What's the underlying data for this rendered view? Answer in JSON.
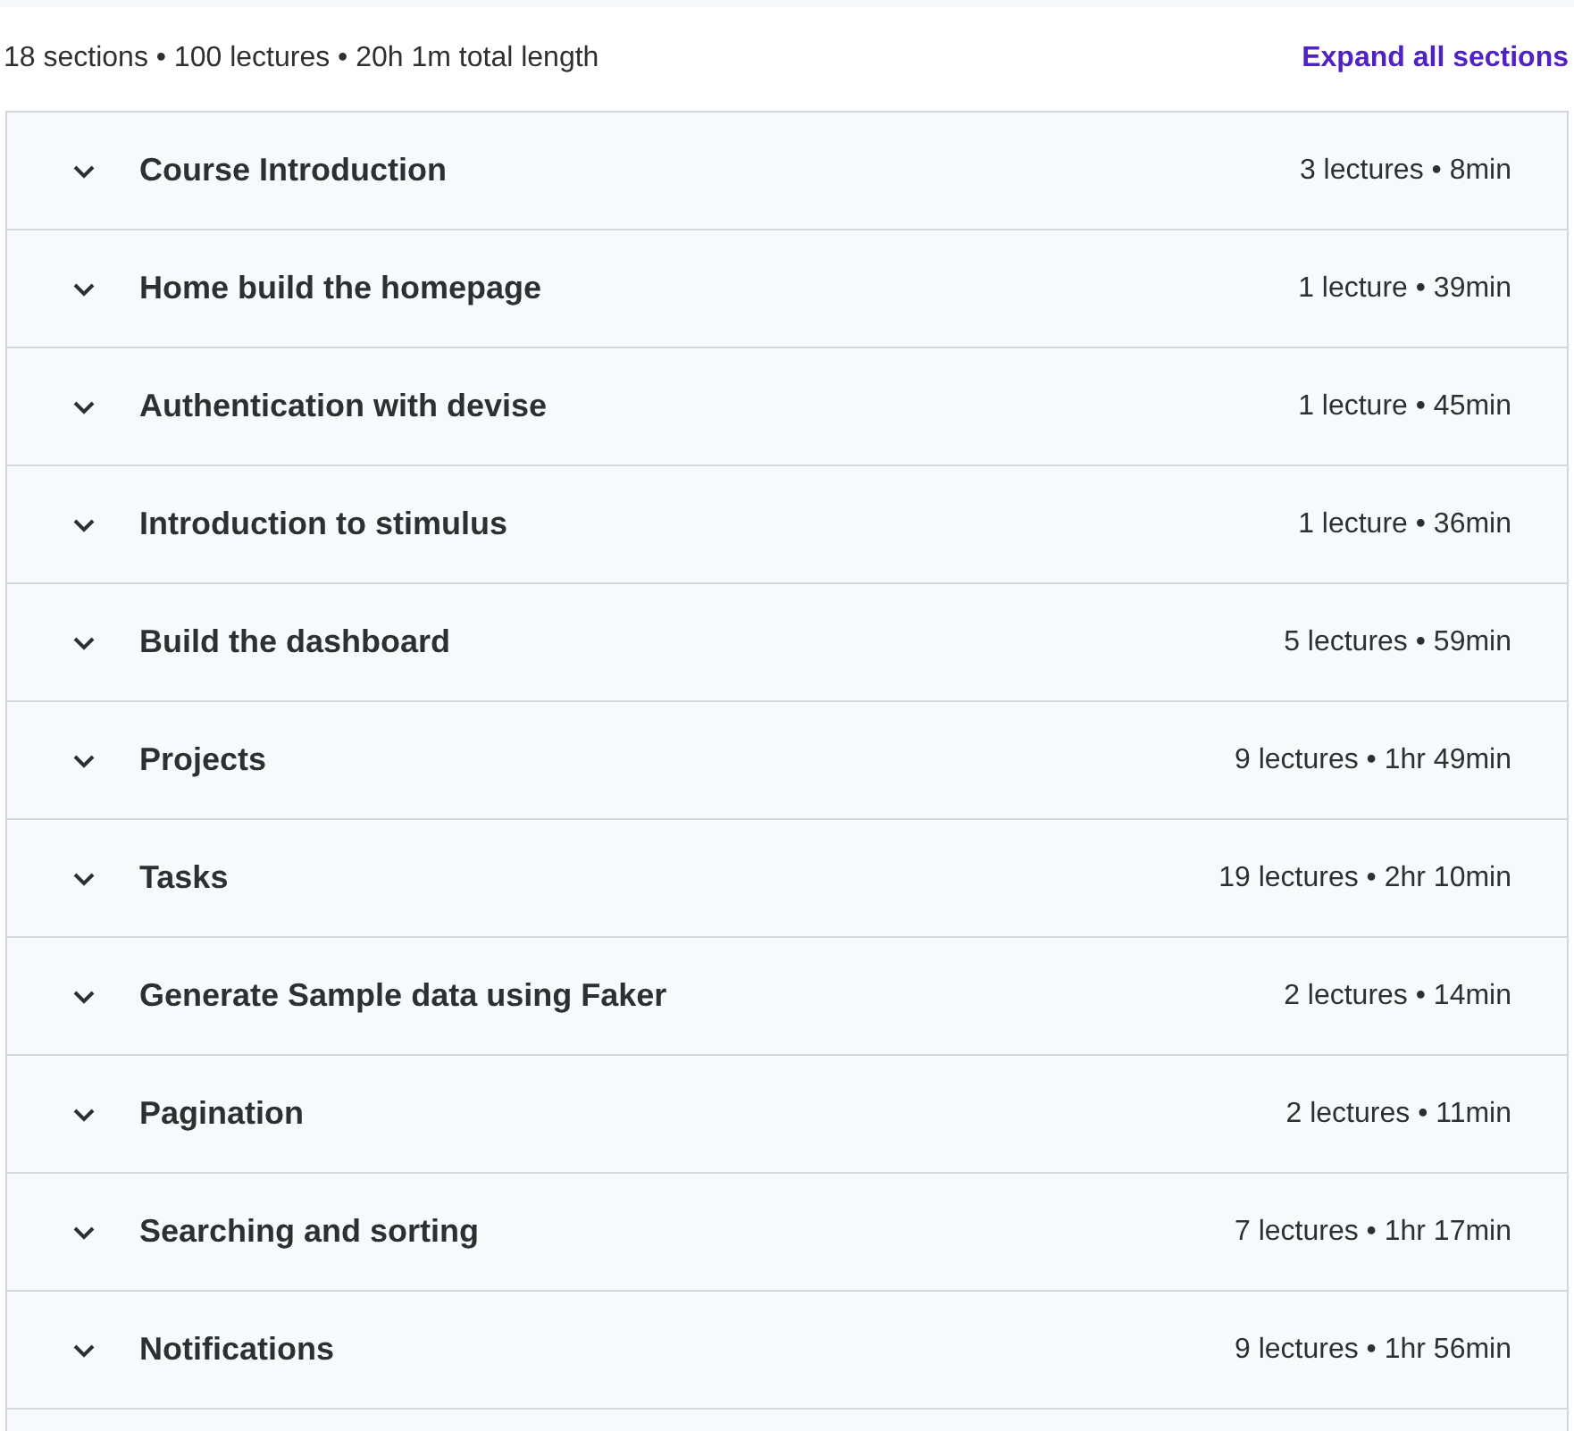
{
  "summary": "18 sections • 100 lectures • 20h 1m total length",
  "expand_all": "Expand all sections",
  "sections": [
    {
      "title": "Course Introduction",
      "meta": "3 lectures • 8min",
      "expanded": false
    },
    {
      "title": "Home build the homepage",
      "meta": "1 lecture • 39min",
      "expanded": false
    },
    {
      "title": "Authentication with devise",
      "meta": "1 lecture • 45min",
      "expanded": false
    },
    {
      "title": "Introduction to stimulus",
      "meta": "1 lecture • 36min",
      "expanded": false
    },
    {
      "title": "Build the dashboard",
      "meta": "5 lectures • 59min",
      "expanded": false
    },
    {
      "title": "Projects",
      "meta": "9 lectures • 1hr 49min",
      "expanded": false
    },
    {
      "title": "Tasks",
      "meta": "19 lectures • 2hr 10min",
      "expanded": false
    },
    {
      "title": "Generate Sample data using Faker",
      "meta": "2 lectures • 14min",
      "expanded": false
    },
    {
      "title": "Pagination",
      "meta": "2 lectures • 11min",
      "expanded": false
    },
    {
      "title": "Searching and sorting",
      "meta": "7 lectures • 1hr 17min",
      "expanded": false
    },
    {
      "title": "Notifications",
      "meta": "9 lectures • 1hr 56min",
      "expanded": false
    }
  ]
}
